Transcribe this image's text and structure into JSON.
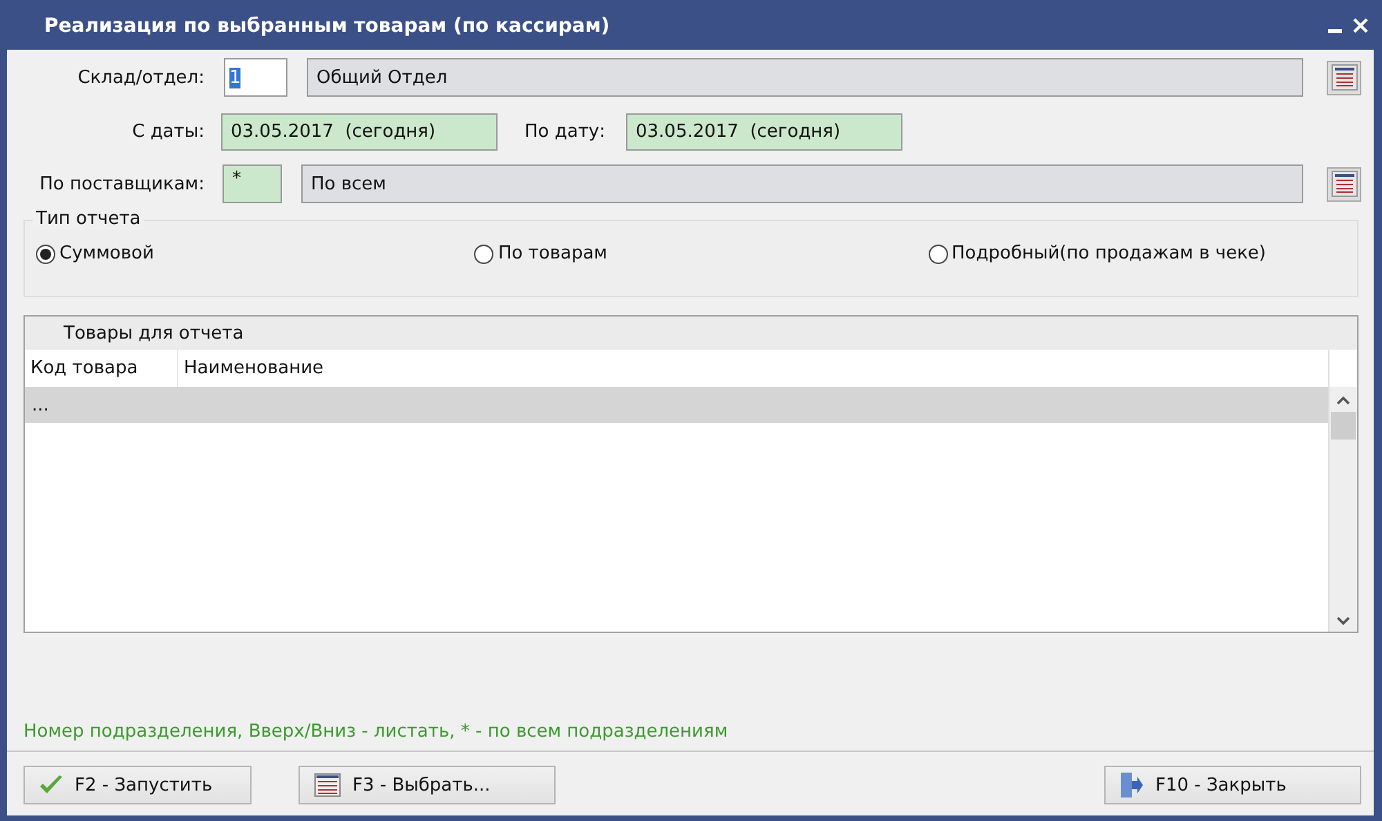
{
  "window": {
    "title": "Реализация по выбранным товарам (по кассирам)"
  },
  "department": {
    "label": "Склад/отдел:",
    "code": "1",
    "code_selected": true,
    "name": "Общий Отдел"
  },
  "date_from": {
    "label": "С даты:",
    "value": "03.05.2017  (сегодня)"
  },
  "date_to": {
    "label": "По дату:",
    "value": "03.05.2017  (сегодня)"
  },
  "suppliers": {
    "label": "По поставщикам:",
    "code": "*",
    "name": "По всем"
  },
  "report_type": {
    "title": "Тип отчета",
    "options": [
      {
        "label": "Суммовой",
        "selected": true
      },
      {
        "label": "По товарам",
        "selected": false
      },
      {
        "label": "Подробный(по продажам в чеке)",
        "selected": false
      }
    ]
  },
  "products": {
    "title": "Товары для отчета",
    "columns": [
      "Код товара",
      "Наименование"
    ],
    "rows": [
      {
        "cells": [
          "..."
        ],
        "selected": true
      }
    ]
  },
  "hint": "Номер подразделения, Вверх/Вниз - листать, * - по всем подразделениям",
  "buttons": [
    {
      "kind": "run",
      "label": "F2 - Запустить"
    },
    {
      "kind": "select",
      "label": "F3 - Выбрать..."
    },
    {
      "kind": "close",
      "label": "F10 - Закрыть"
    }
  ]
}
